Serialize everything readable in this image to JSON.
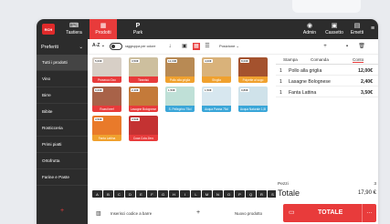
{
  "app": {
    "logo": "RCH"
  },
  "nav": {
    "tabs": [
      {
        "label": "Tastiera"
      },
      {
        "label": "Prodotti"
      },
      {
        "label": "Park"
      }
    ],
    "right": [
      {
        "label": "Admin"
      },
      {
        "label": "Cassetto"
      },
      {
        "label": "Emetti"
      }
    ]
  },
  "toolbar": {
    "preferiti": "Preferiti",
    "sort": "A-Z",
    "toggle_label": "raggruppa per colore",
    "position_label": "Posizione"
  },
  "sidebar": {
    "items": [
      {
        "label": "Tutti i prodotti"
      },
      {
        "label": "Vino"
      },
      {
        "label": "Birre"
      },
      {
        "label": "Bibite"
      },
      {
        "label": "Rosticceria"
      },
      {
        "label": "Primi piatti"
      },
      {
        "label": "Ortofrutta"
      },
      {
        "label": "Farine e Paste"
      }
    ]
  },
  "products": [
    {
      "label": "Prosecco Doc",
      "price": "5,00€",
      "color": "#e83b3b",
      "img": "#d7cfc6"
    },
    {
      "label": "Tiramisù",
      "price": "3,50€",
      "color": "#e83b3b",
      "img": "#cdbf9e"
    },
    {
      "label": "Pollo alla griglia",
      "price": "12,00€",
      "color": "#f0a12e",
      "img": "#b88a54"
    },
    {
      "label": "Sfoglia",
      "price": "4,00€",
      "color": "#f0a12e",
      "img": "#d9b27a"
    },
    {
      "label": "Polpette al sugo",
      "price": "8,00€",
      "color": "#f0a12e",
      "img": "#a4522e"
    },
    {
      "label": "Roast beef",
      "price": "9,00€",
      "color": "#e83b3b",
      "img": "#a86248"
    },
    {
      "label": "Lasagne Bolognese",
      "price": "2,40€",
      "color": "#e83b3b",
      "img": "#c47a3a"
    },
    {
      "label": "S. Pellegrino 75cl",
      "price": "1,50€",
      "color": "#3aa6d8",
      "img": "#bfe0d7"
    },
    {
      "label": "Acqua Panna 75cl",
      "price": "1,50€",
      "color": "#3aa6d8",
      "img": "#d7e7ef"
    },
    {
      "label": "Acqua Naturale 1,5l",
      "price": "0,80€",
      "color": "#3aa6d8",
      "img": "#cfe2ea"
    },
    {
      "label": "Fanta Lattina",
      "price": "3,50€",
      "color": "#f0a12e",
      "img": "#e97a2a"
    },
    {
      "label": "Coca Cola Zero",
      "price": "3,50€",
      "color": "#e83b3b",
      "img": "#c43232"
    }
  ],
  "letters": [
    "A",
    "B",
    "C",
    "D",
    "E",
    "F",
    "G",
    "H",
    "I",
    "L",
    "M",
    "N",
    "O",
    "P",
    "Q",
    "R",
    "S",
    "T",
    "U",
    "V"
  ],
  "barcode": {
    "label": "Inserisci codice a barre",
    "plus": "+",
    "new_product": "Nuovo prodotto"
  },
  "order": {
    "headers": {
      "stampa": "Stampa",
      "comanda": "Comanda",
      "conto": "Conto"
    },
    "items": [
      {
        "qty": "1",
        "name": "Pollo alla griglia",
        "price": "12,00€"
      },
      {
        "qty": "1",
        "name": "Lasagne Bolognese",
        "price": "2,40€"
      },
      {
        "qty": "1",
        "name": "Fanta Lattina",
        "price": "3,50€"
      }
    ]
  },
  "totals": {
    "pezzi_label": "Pezzi",
    "pezzi": "3",
    "totale_label": "Totale",
    "totale": "17,90 €",
    "button": "TOTALE"
  },
  "colors": {
    "accent": "#e83b3b",
    "dark": "#2c2c2c"
  }
}
